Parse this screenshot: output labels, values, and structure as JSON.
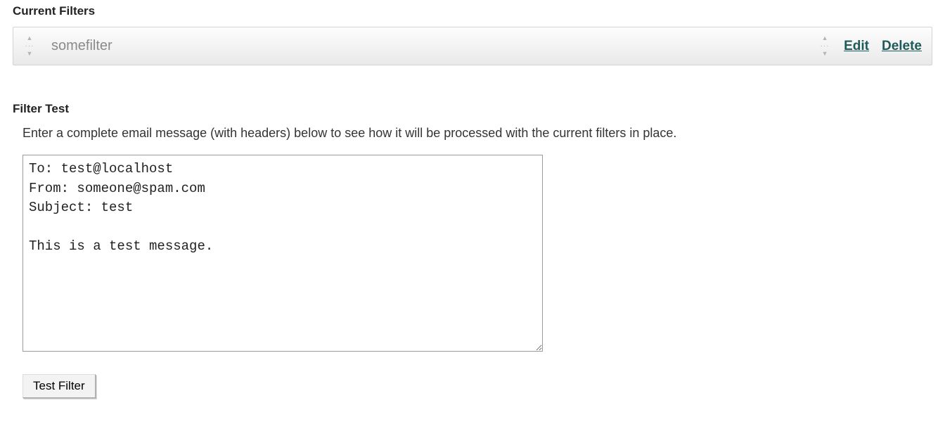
{
  "current_filters": {
    "heading": "Current Filters",
    "items": [
      {
        "name": "somefilter",
        "edit_label": "Edit",
        "delete_label": "Delete"
      }
    ]
  },
  "filter_test": {
    "heading": "Filter Test",
    "instruction": "Enter a complete email message (with headers) below to see how it will be processed with the current filters in place.",
    "textarea_value": "To: test@localhost\nFrom: someone@spam.com\nSubject: test\n\nThis is a test message.",
    "button_label": "Test Filter"
  }
}
